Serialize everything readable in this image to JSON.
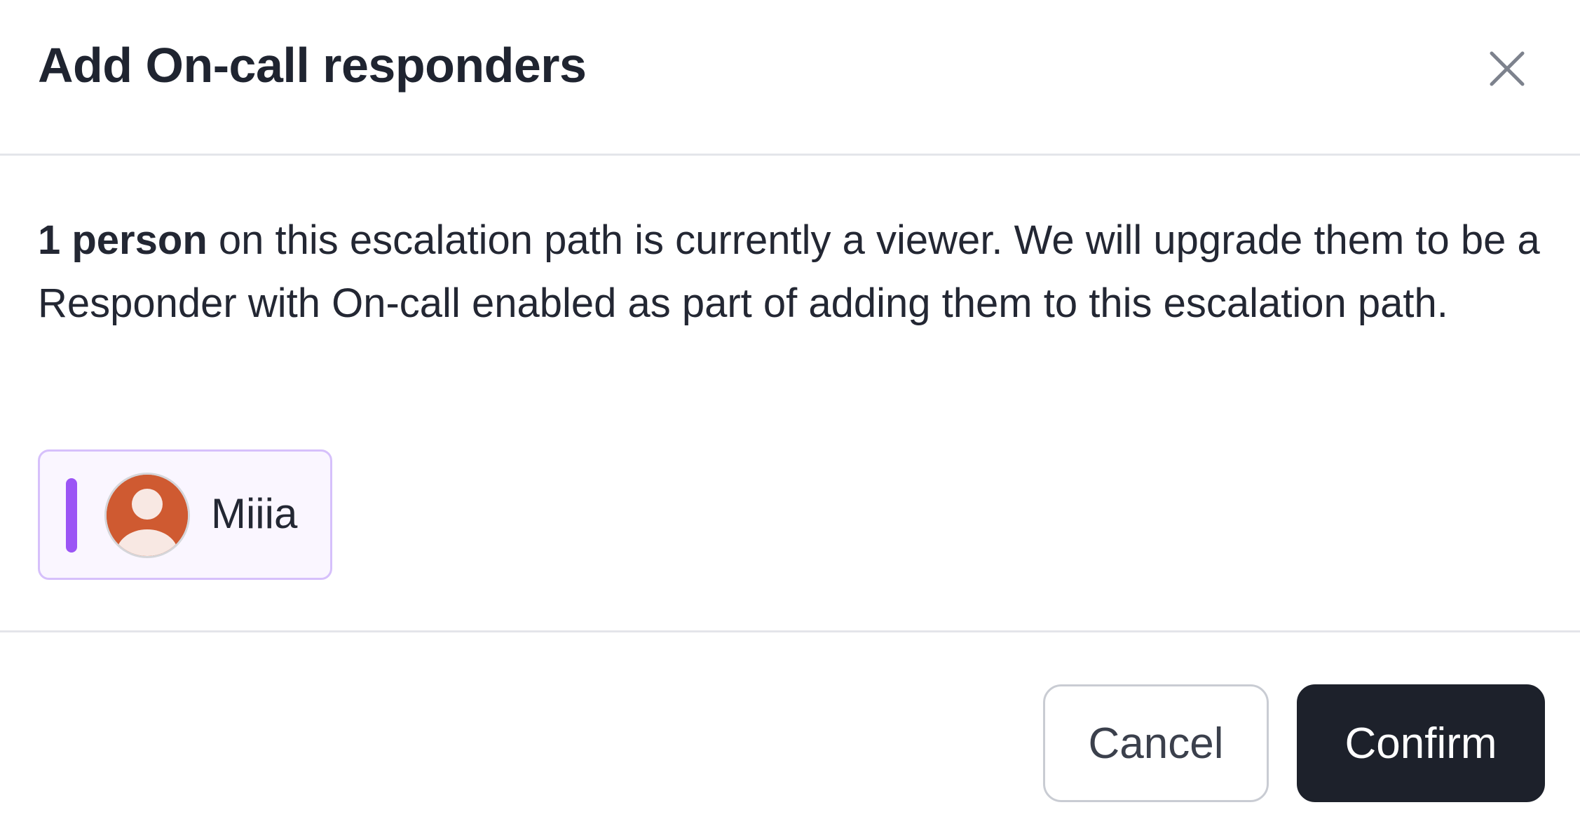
{
  "dialog": {
    "title": "Add On-call responders",
    "close_icon": "close-icon"
  },
  "body": {
    "message_strong": "1 person",
    "message_rest": " on this escalation path is currently a viewer. We will upgrade them to be a Responder with On-call enabled as part of adding them to this escalation path."
  },
  "people": [
    {
      "name": "Miiia",
      "avatar_icon": "person-avatar-icon",
      "accent_color": "#9b55f5",
      "avatar_color": "#cf5a31"
    }
  ],
  "footer": {
    "cancel_label": "Cancel",
    "confirm_label": "Confirm"
  },
  "colors": {
    "primary_button": "#1d212b",
    "chip_border": "#d6c0fb",
    "chip_background": "#faf6ff"
  }
}
